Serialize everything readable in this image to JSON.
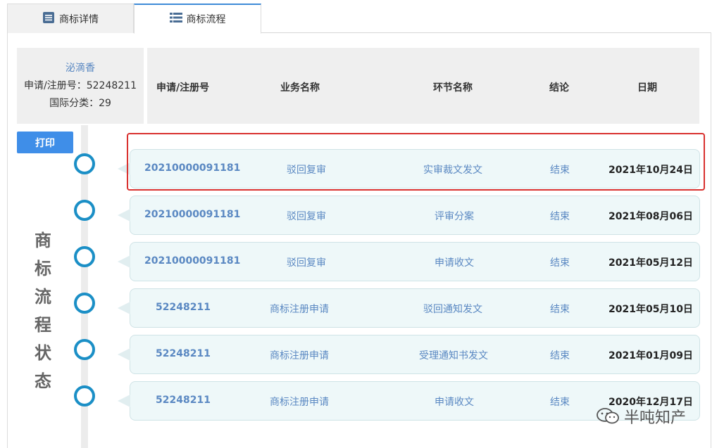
{
  "tabs": [
    {
      "label": "商标详情",
      "icon": "document-list-icon"
    },
    {
      "label": "商标流程",
      "icon": "list-icon"
    }
  ],
  "trademark": {
    "name": "泌滴香",
    "reg_line": "申请/注册号：52248211",
    "class_line": "国际分类：29"
  },
  "columns": {
    "reg_no": "申请/注册号",
    "business": "业务名称",
    "stage": "环节名称",
    "result": "结论",
    "date": "日期"
  },
  "print_label": "打印",
  "side_title": [
    "商",
    "标",
    "流",
    "程",
    "状",
    "态"
  ],
  "rows": [
    {
      "reg_no": "20210000091181",
      "business": "驳回复审",
      "stage": "实审裁文发文",
      "result": "结束",
      "date": "2021年10月24日"
    },
    {
      "reg_no": "20210000091181",
      "business": "驳回复审",
      "stage": "评审分案",
      "result": "结束",
      "date": "2021年08月06日"
    },
    {
      "reg_no": "20210000091181",
      "business": "驳回复审",
      "stage": "申请收文",
      "result": "结束",
      "date": "2021年05月12日"
    },
    {
      "reg_no": "52248211",
      "business": "商标注册申请",
      "stage": "驳回通知发文",
      "result": "结束",
      "date": "2021年05月10日"
    },
    {
      "reg_no": "52248211",
      "business": "商标注册申请",
      "stage": "受理通知书发文",
      "result": "结束",
      "date": "2021年01月09日"
    },
    {
      "reg_no": "52248211",
      "business": "商标注册申请",
      "stage": "申请收文",
      "result": "结束",
      "date": "2020年12月17日"
    }
  ],
  "watermark": {
    "text": "半吨知产",
    "icon": "wechat-icon"
  },
  "colors": {
    "accent": "#3f8ee8",
    "timeline": "#1b8fc6",
    "highlight": "#d9312f",
    "link": "#5a88c2"
  }
}
